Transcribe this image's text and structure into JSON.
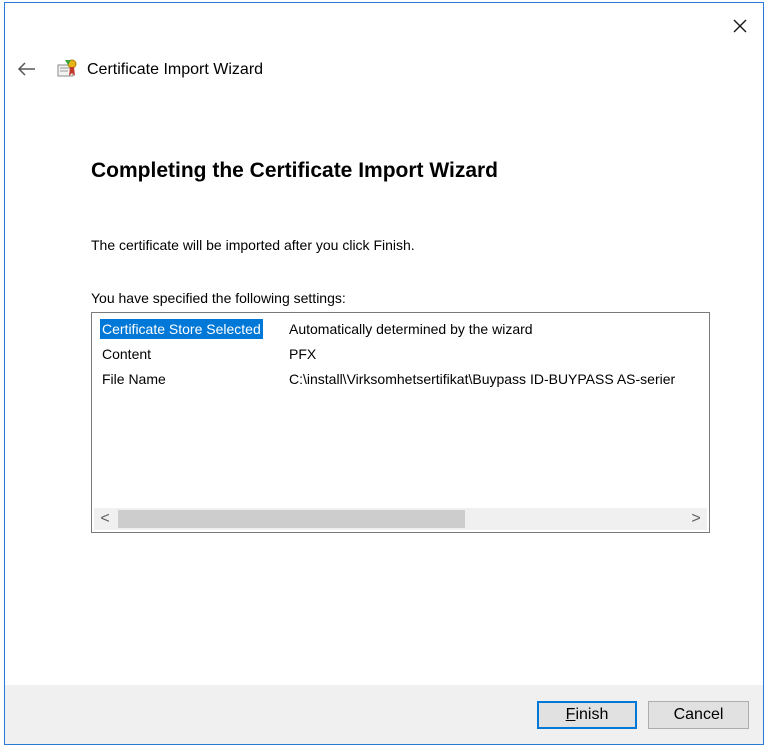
{
  "window": {
    "title": "Certificate Import Wizard",
    "close_icon": "close-icon",
    "back_icon": "back-arrow-icon",
    "app_icon": "certificate-icon"
  },
  "page": {
    "heading": "Completing the Certificate Import Wizard",
    "info_text": "The certificate will be imported after you click Finish.",
    "settings_label": "You have specified the following settings:"
  },
  "settings": {
    "rows": [
      {
        "name": "Certificate Store Selected",
        "value": "Automatically determined by the wizard"
      },
      {
        "name": "Content",
        "value": "PFX"
      },
      {
        "name": "File Name",
        "value": "C:\\install\\Virksomhetsertifikat\\Buypass ID-BUYPASS AS-serier"
      }
    ],
    "scroll_left_glyph": "<",
    "scroll_right_glyph": ">"
  },
  "buttons": {
    "finish_label": "Finish",
    "cancel_label": "Cancel"
  },
  "colors": {
    "selection": "#0078d7",
    "window_border": "#2b79d7",
    "footer_bg": "#f0f0f0"
  }
}
